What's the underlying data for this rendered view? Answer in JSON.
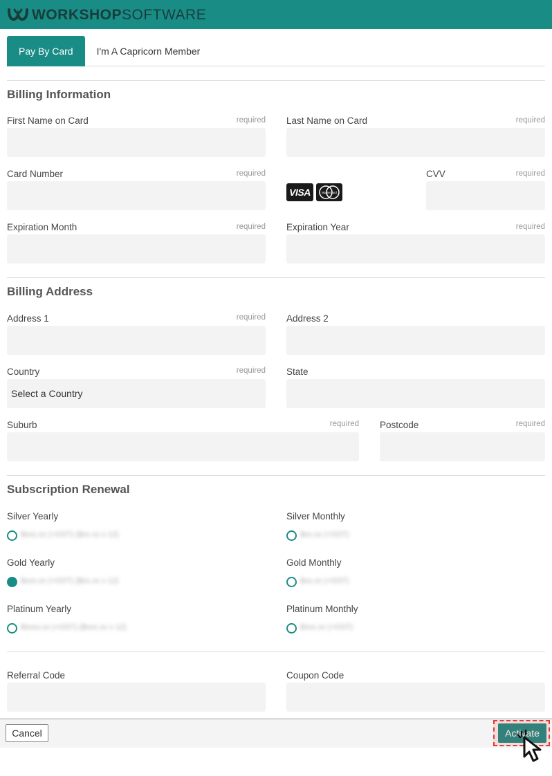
{
  "brand": {
    "name_bold": "WORKSHOP",
    "name_light": "SOFTWARE",
    "accent": "#1a8c86"
  },
  "tabs": [
    {
      "label": "Pay By Card",
      "active": true
    },
    {
      "label": "I'm A Capricorn Member",
      "active": false
    }
  ],
  "billing_info": {
    "title": "Billing Information",
    "first_name": {
      "label": "First Name on Card",
      "required": "required",
      "value": ""
    },
    "last_name": {
      "label": "Last Name on Card",
      "required": "required",
      "value": ""
    },
    "card_number": {
      "label": "Card Number",
      "required": "required",
      "value": ""
    },
    "card_logos": {
      "visa": "VISA",
      "mastercard": "MasterCard"
    },
    "cvv": {
      "label": "CVV",
      "required": "required",
      "value": ""
    },
    "exp_month": {
      "label": "Expiration Month",
      "required": "required",
      "value": ""
    },
    "exp_year": {
      "label": "Expiration Year",
      "required": "required",
      "value": ""
    }
  },
  "billing_address": {
    "title": "Billing Address",
    "address1": {
      "label": "Address 1",
      "required": "required",
      "value": ""
    },
    "address2": {
      "label": "Address 2",
      "value": ""
    },
    "country": {
      "label": "Country",
      "required": "required",
      "value": "Select a Country"
    },
    "state": {
      "label": "State",
      "value": ""
    },
    "suburb": {
      "label": "Suburb",
      "required": "required",
      "value": ""
    },
    "postcode": {
      "label": "Postcode",
      "required": "required",
      "value": ""
    }
  },
  "subscription": {
    "title": "Subscription Renewal",
    "plans": [
      {
        "label": "Silver Yearly",
        "price": "$xxx.xx (+GST) ($xx.xx x 12)",
        "selected": false
      },
      {
        "label": "Silver Monthly",
        "price": "$xx.xx (+GST)",
        "selected": false
      },
      {
        "label": "Gold Yearly",
        "price": "$xxx.xx (+GST) ($xx.xx x 12)",
        "selected": true
      },
      {
        "label": "Gold Monthly",
        "price": "$xx.xx (+GST)",
        "selected": false
      },
      {
        "label": "Platinum Yearly",
        "price": "$xxxx.xx (+GST) ($xxx.xx x 12)",
        "selected": false
      },
      {
        "label": "Platinum Monthly",
        "price": "$xxx.xx (+GST)",
        "selected": false
      }
    ]
  },
  "codes": {
    "referral": {
      "label": "Referral Code",
      "value": ""
    },
    "coupon": {
      "label": "Coupon Code",
      "value": ""
    }
  },
  "footer": {
    "cancel_label": "Cancel",
    "activate_label": "Activate"
  }
}
